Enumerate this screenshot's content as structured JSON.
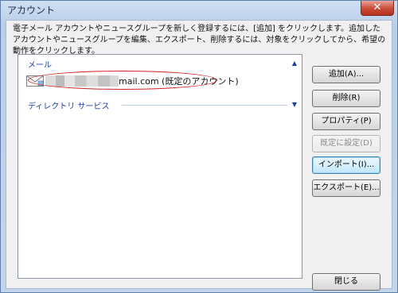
{
  "window": {
    "title": "アカウント",
    "close_glyph": "✕"
  },
  "description": "電子メール アカウントやニュースグループを新しく登録するには、[追加] をクリックします。追加したアカウントやニュースグループを編集、エクスポート、削除するには、対象をクリックしてから、希望の動作をクリックします。",
  "list": {
    "groups": {
      "mail": {
        "label": "メール",
        "chevron": "▲"
      },
      "directory": {
        "label": "ディレクトリ サービス",
        "chevron": "▼"
      }
    },
    "account": {
      "label": "mail.com (既定のアカウント)"
    }
  },
  "buttons": {
    "add": "追加(A)...",
    "delete": "削除(R)",
    "properties": "プロパティ(P)",
    "set_default": "既定に設定(D)",
    "import": "インポート(I)...",
    "export": "エクスポート(E)...",
    "close": "閉じる"
  },
  "colors": {
    "highlight": "#d42222",
    "group_header": "#1e3ea8"
  }
}
